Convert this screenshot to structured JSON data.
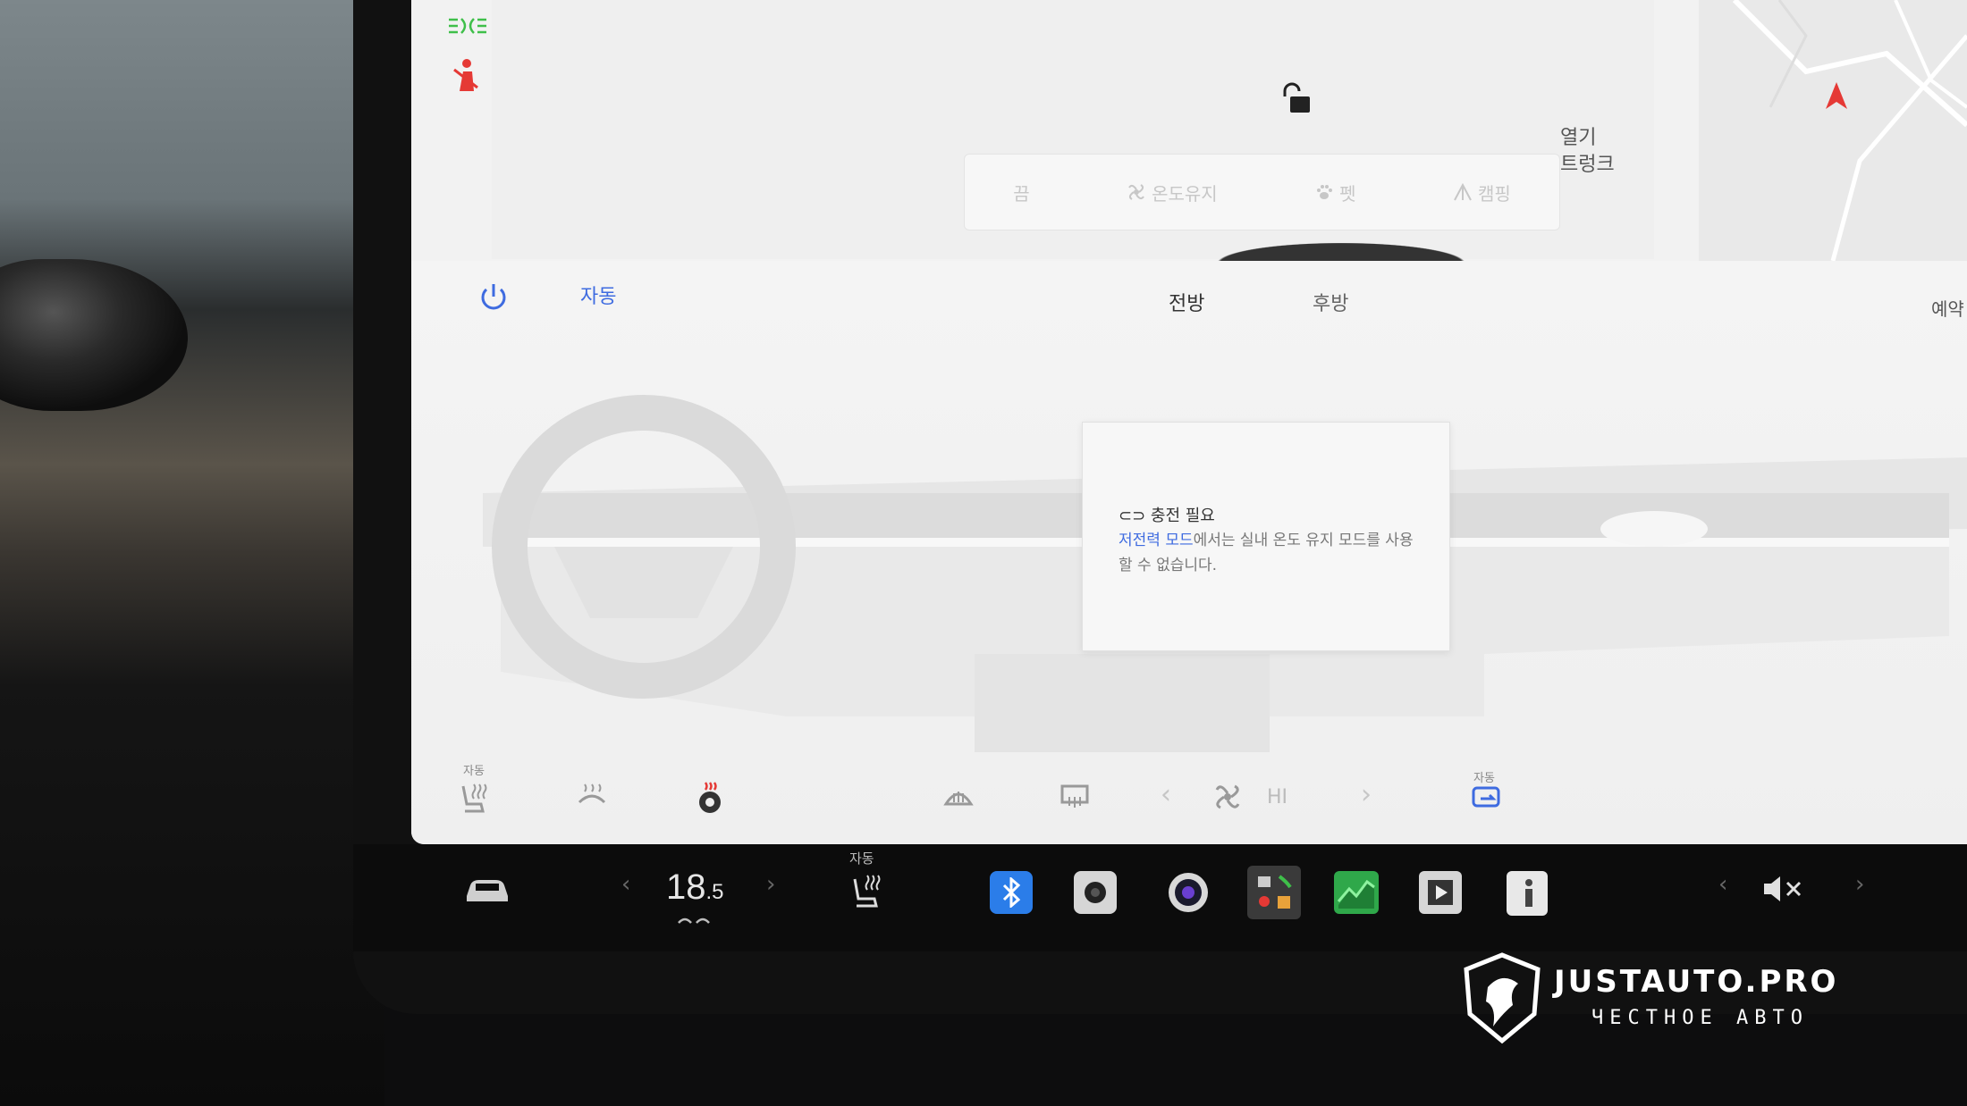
{
  "status": {
    "headlights_icon": "headlight-icon",
    "seatbelt_icon": "seatbelt-warning-icon"
  },
  "top": {
    "trunk_open_label": "열기",
    "trunk_label": "트렁크",
    "modes": [
      {
        "icon": "",
        "label": "끔"
      },
      {
        "icon": "fan-icon",
        "label": "온도유지"
      },
      {
        "icon": "paw-icon",
        "label": "펫"
      },
      {
        "icon": "tent-icon",
        "label": "캠핑"
      }
    ]
  },
  "climate": {
    "auto_label": "자동",
    "tabs": [
      "전방",
      "후방"
    ],
    "reserve_label": "예약",
    "popup": {
      "title": "충전 필요",
      "body_link": "저전력 모드",
      "body_rest": "에서는 실내 온도 유지 모드를 사용할 수 없습니다."
    },
    "seat_auto_label": "자동",
    "recirc_auto_label": "자동",
    "fan_value": "HI"
  },
  "taskbar": {
    "temp_main": "18",
    "temp_dec": ".5",
    "seat_auto_label": "자동"
  },
  "brand": {
    "title": "JUSTAUTO.PRO",
    "subtitle": "ЧЕСТНОЕ АВТО"
  },
  "colors": {
    "accent_blue": "#3e6be0",
    "alert_red": "#e53935",
    "indicator_green": "#3fbf4a"
  }
}
